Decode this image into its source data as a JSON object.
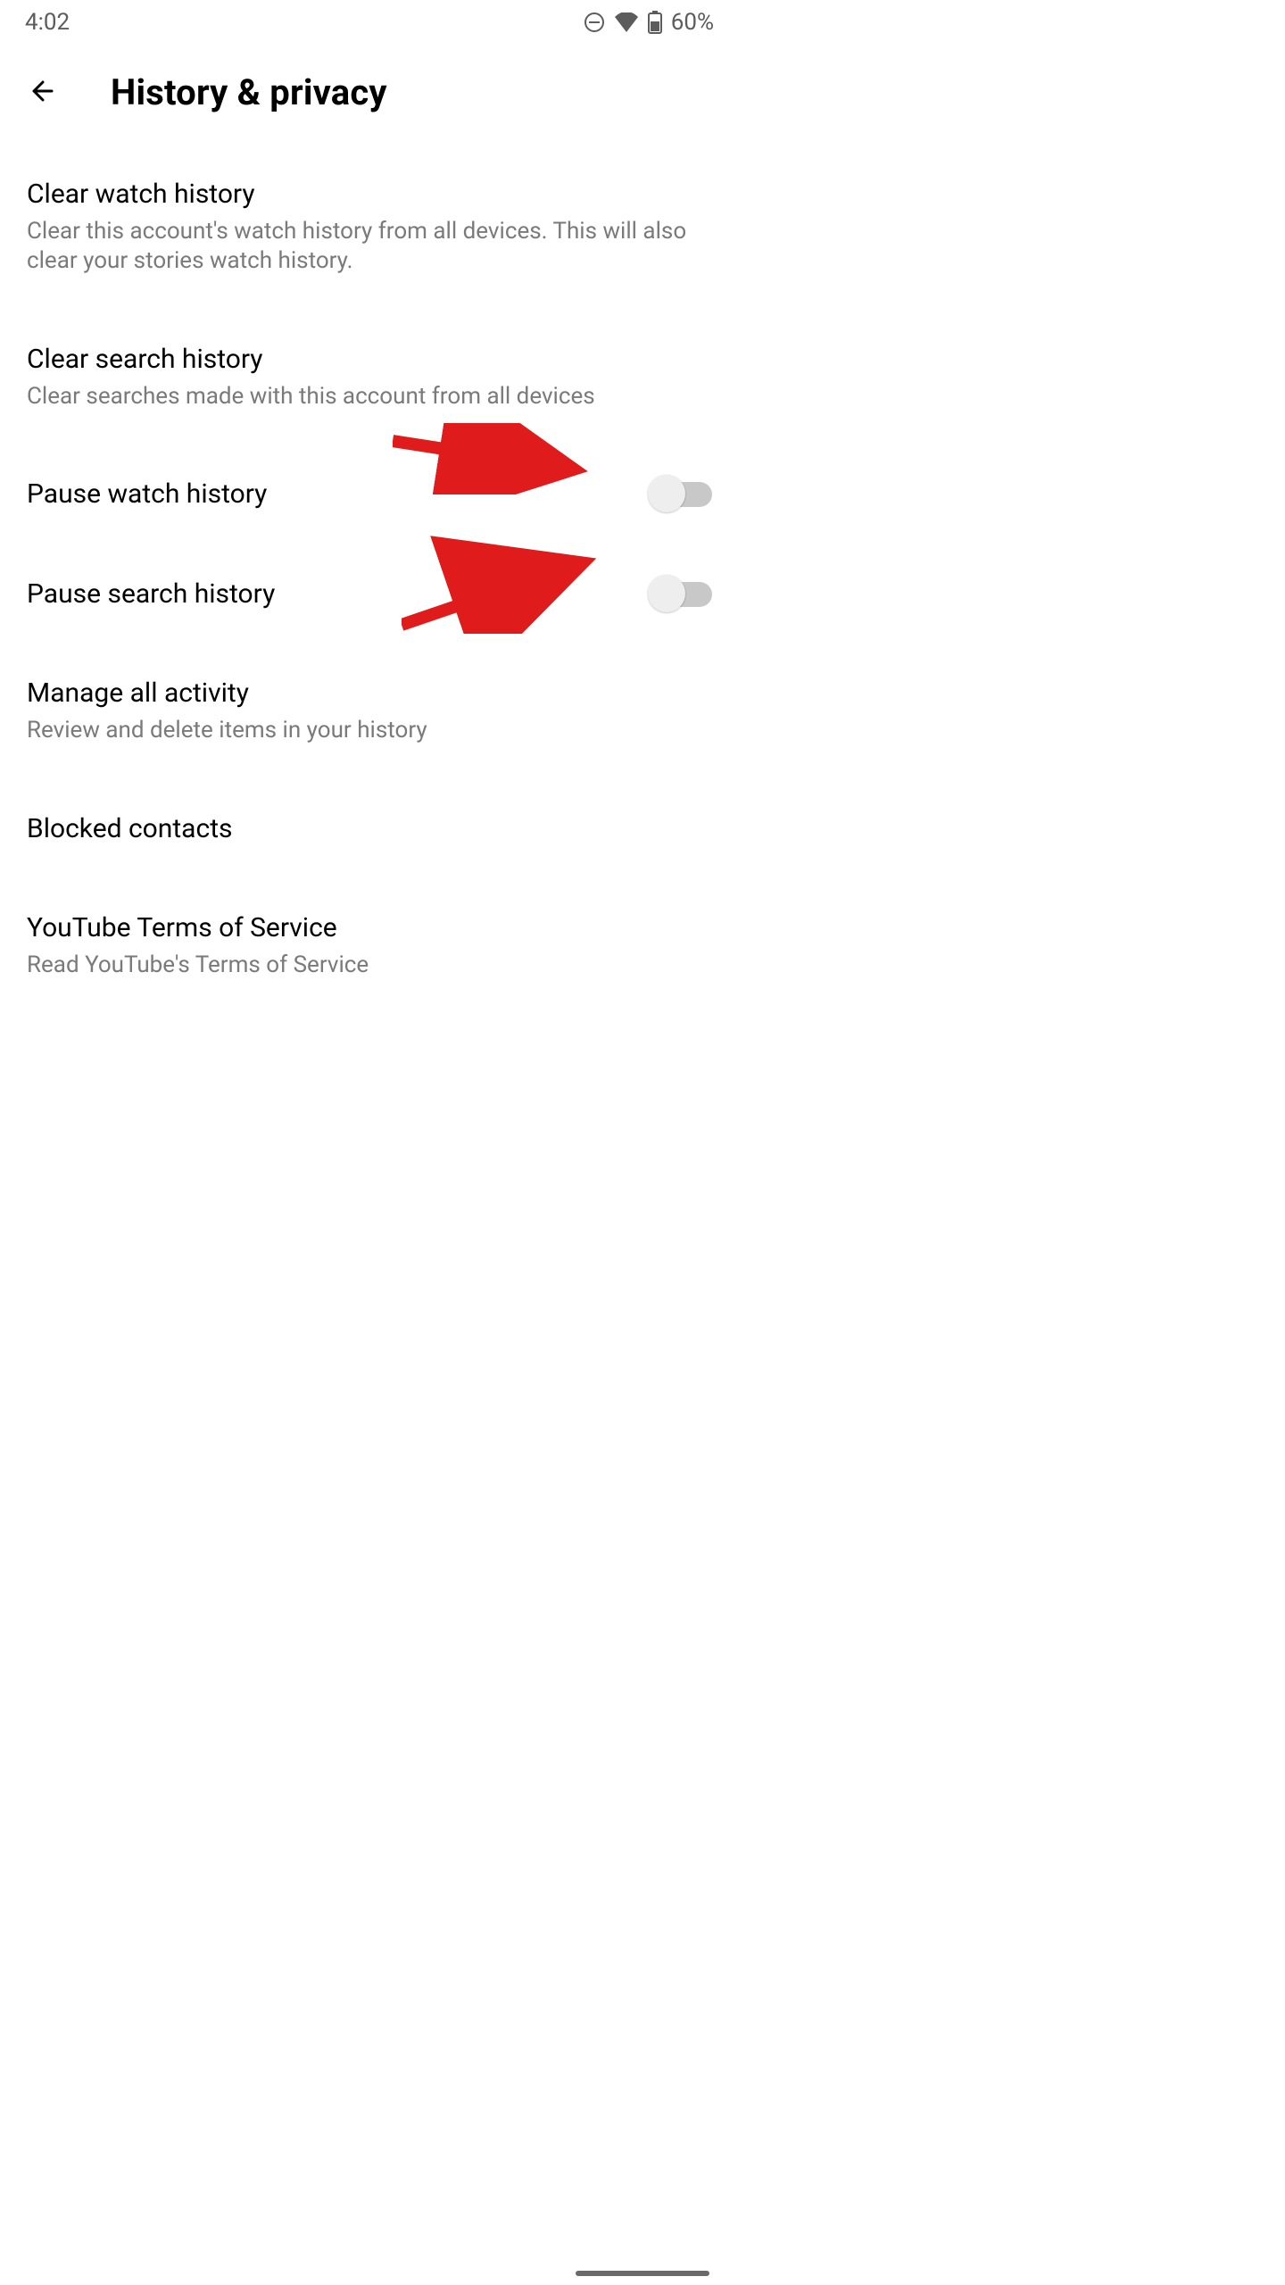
{
  "status": {
    "time": "4:02",
    "battery_text": "60%"
  },
  "header": {
    "title": "History & privacy"
  },
  "rows": {
    "clear_watch": {
      "title": "Clear watch history",
      "sub": "Clear this account's watch history from all devices. This will also clear your stories watch history."
    },
    "clear_search": {
      "title": "Clear search history",
      "sub": "Clear searches made with this account from all devices"
    },
    "pause_watch": {
      "title": "Pause watch history",
      "toggle": false
    },
    "pause_search": {
      "title": "Pause search history",
      "toggle": false
    },
    "manage": {
      "title": "Manage all activity",
      "sub": "Review and delete items in your history"
    },
    "blocked": {
      "title": "Blocked contacts"
    },
    "tos": {
      "title": "YouTube Terms of Service",
      "sub": "Read YouTube's Terms of Service"
    }
  },
  "annotations": {
    "arrow_color": "#e01b1b"
  }
}
